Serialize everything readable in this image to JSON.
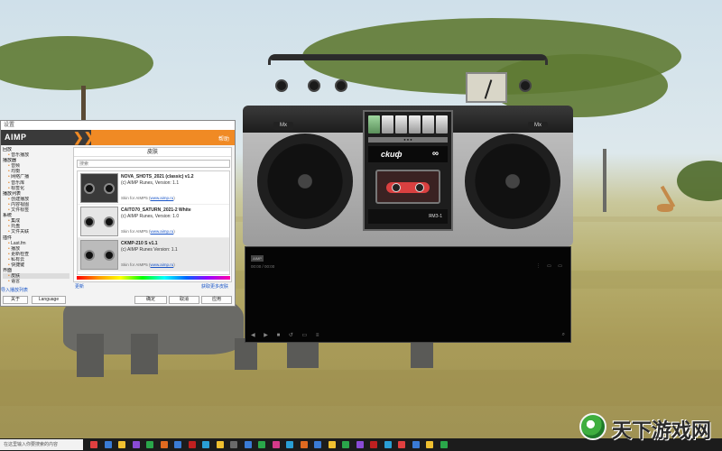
{
  "settings_window": {
    "title": "设置",
    "brand": "AIMP",
    "brand_right": "帮助",
    "tree": [
      {
        "label": "回放",
        "type": "group"
      },
      {
        "label": "音乐播放",
        "type": "child"
      },
      {
        "label": "播放器",
        "type": "group"
      },
      {
        "label": "音频",
        "type": "child"
      },
      {
        "label": "均衡",
        "type": "child"
      },
      {
        "label": "网络广播",
        "type": "child"
      },
      {
        "label": "音乐库",
        "type": "child"
      },
      {
        "label": "标签化",
        "type": "child"
      },
      {
        "label": "播放列表",
        "type": "group"
      },
      {
        "label": "创建播放",
        "type": "child"
      },
      {
        "label": "内容视图",
        "type": "child"
      },
      {
        "label": "文件标签",
        "type": "child"
      },
      {
        "label": "系统",
        "type": "group"
      },
      {
        "label": "集成",
        "type": "child"
      },
      {
        "label": "托盘",
        "type": "child"
      },
      {
        "label": "文件关联",
        "type": "child"
      },
      {
        "label": "插件",
        "type": "group"
      },
      {
        "label": "Last.fm",
        "type": "child"
      },
      {
        "label": "播放",
        "type": "child"
      },
      {
        "label": "更新检查",
        "type": "child"
      },
      {
        "label": "私有云",
        "type": "child"
      },
      {
        "label": "快捷键",
        "type": "child"
      },
      {
        "label": "界面",
        "type": "group"
      },
      {
        "label": "皮肤",
        "type": "child",
        "selected": true
      },
      {
        "label": "语言",
        "type": "child"
      }
    ],
    "panel_header": "皮肤",
    "search_placeholder": "搜索",
    "skins": [
      {
        "name": "NOVA_SHOTS_2021 (classic) v1.2",
        "author": "(c) AIMP Runes, Version: 1.1",
        "link_prefix": "Skin for AIMP5",
        "link_url": "www.aimp.ru"
      },
      {
        "name": "CAITO70_SATURN_2021-2 White",
        "author": "(c) AIMP Runes, Version: 1.0",
        "link_prefix": "Skin for AIMP5",
        "link_url": "www.aimp.ru"
      },
      {
        "name": "CKMP-210 S v1.1",
        "author": "(c) AIMP Runes Version: 1.1",
        "link_prefix": "Skin for AIMP5",
        "link_url": "www.aimp.ru"
      }
    ],
    "link_left": "更新",
    "link_right": "获取更多皮肤",
    "bottom_left_link": "导入播放列表",
    "buttons": {
      "about": "关于",
      "language": "Language",
      "ok": "确定",
      "cancel": "取消",
      "apply": "应用"
    }
  },
  "boombox": {
    "mx_left": "Mx",
    "mx_right": "Mx",
    "deck_strip": "● ● ●",
    "brand": "ckuф",
    "brand_symbol": "∞",
    "model": "ЯМЗ-1"
  },
  "viz_panel": {
    "badge": "AIMP",
    "time": "00:00 / 00:00",
    "right_icons": "⋮ ▭ ▭",
    "controls": "◀ ▶ ■ ↺ ▭ ≡",
    "search": "⌕"
  },
  "taskbar": {
    "search_placeholder": "在这里输入你要搜索的内容",
    "icon_colors": [
      "#e04040",
      "#3a7bd5",
      "#f0c030",
      "#8a4bd5",
      "#2aa64a",
      "#e06a20",
      "#3a7bd5",
      "#c02020",
      "#2a9fd5",
      "#f0c030",
      "#6a6a6a",
      "#3a7bd5",
      "#2aa64a",
      "#d53a8a",
      "#2a9fd5",
      "#e06a20",
      "#3a7bd5",
      "#f0c030",
      "#2aa64a",
      "#8a4bd5",
      "#c02020",
      "#2a9fd5",
      "#e04040",
      "#3a7bd5",
      "#f0c030",
      "#2aa64a"
    ]
  },
  "watermark": {
    "text": "天下游戏网"
  }
}
